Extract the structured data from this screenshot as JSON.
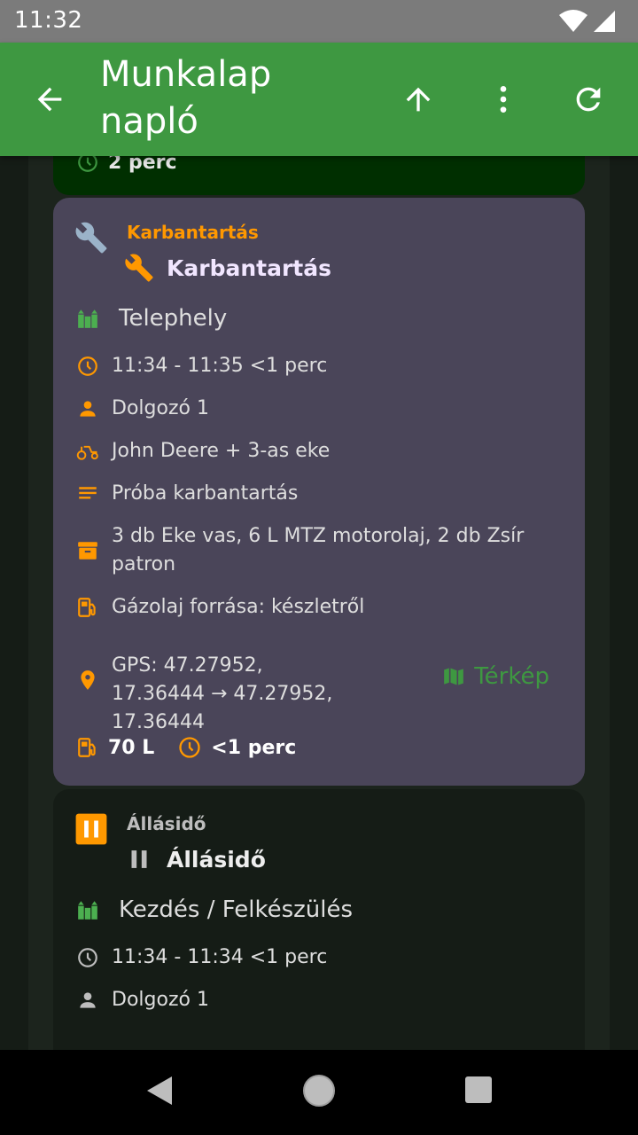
{
  "status_bar": {
    "time": "11:32",
    "icons": [
      "wifi-icon",
      "signal-icon"
    ]
  },
  "app_bar": {
    "title": "Munkalap napló",
    "icons": [
      "back-arrow-icon",
      "arrow-up-icon",
      "more-vert-icon",
      "refresh-icon"
    ]
  },
  "colors": {
    "app_bar": "#3e9841",
    "accent_orange": "#ff9800",
    "card_maintenance": "#4a4559",
    "card_green": "#002f00",
    "map_green": "#3e9841",
    "site_green": "#4caf50"
  },
  "cards": [
    {
      "type": "previous",
      "duration": "2 perc"
    },
    {
      "type": "maintenance",
      "category": "Karbantartás",
      "title": "Karbantartás",
      "site": "Telephely",
      "time": "11:34 - 11:35 <1 perc",
      "worker": "Dolgozó 1",
      "machine": "John Deere + 3-as eke",
      "note": "Próba karbantartás",
      "materials": "3 db Eke vas, 6 L MTZ motorolaj, 2 db Zsír patron",
      "fuel_source": "Gázolaj forrása: készletről",
      "gps": "GPS: 47.27952, 17.36444 → 47.27952, 17.36444",
      "map_label": "Térkép",
      "fuel_amount": "70 L",
      "duration": "<1 perc"
    },
    {
      "type": "stop",
      "category": "Állásidő",
      "title": "Állásidő",
      "site": "Kezdés / Felkészülés",
      "time": "11:34 - 11:34 <1 perc",
      "worker": "Dolgozó 1"
    }
  ]
}
